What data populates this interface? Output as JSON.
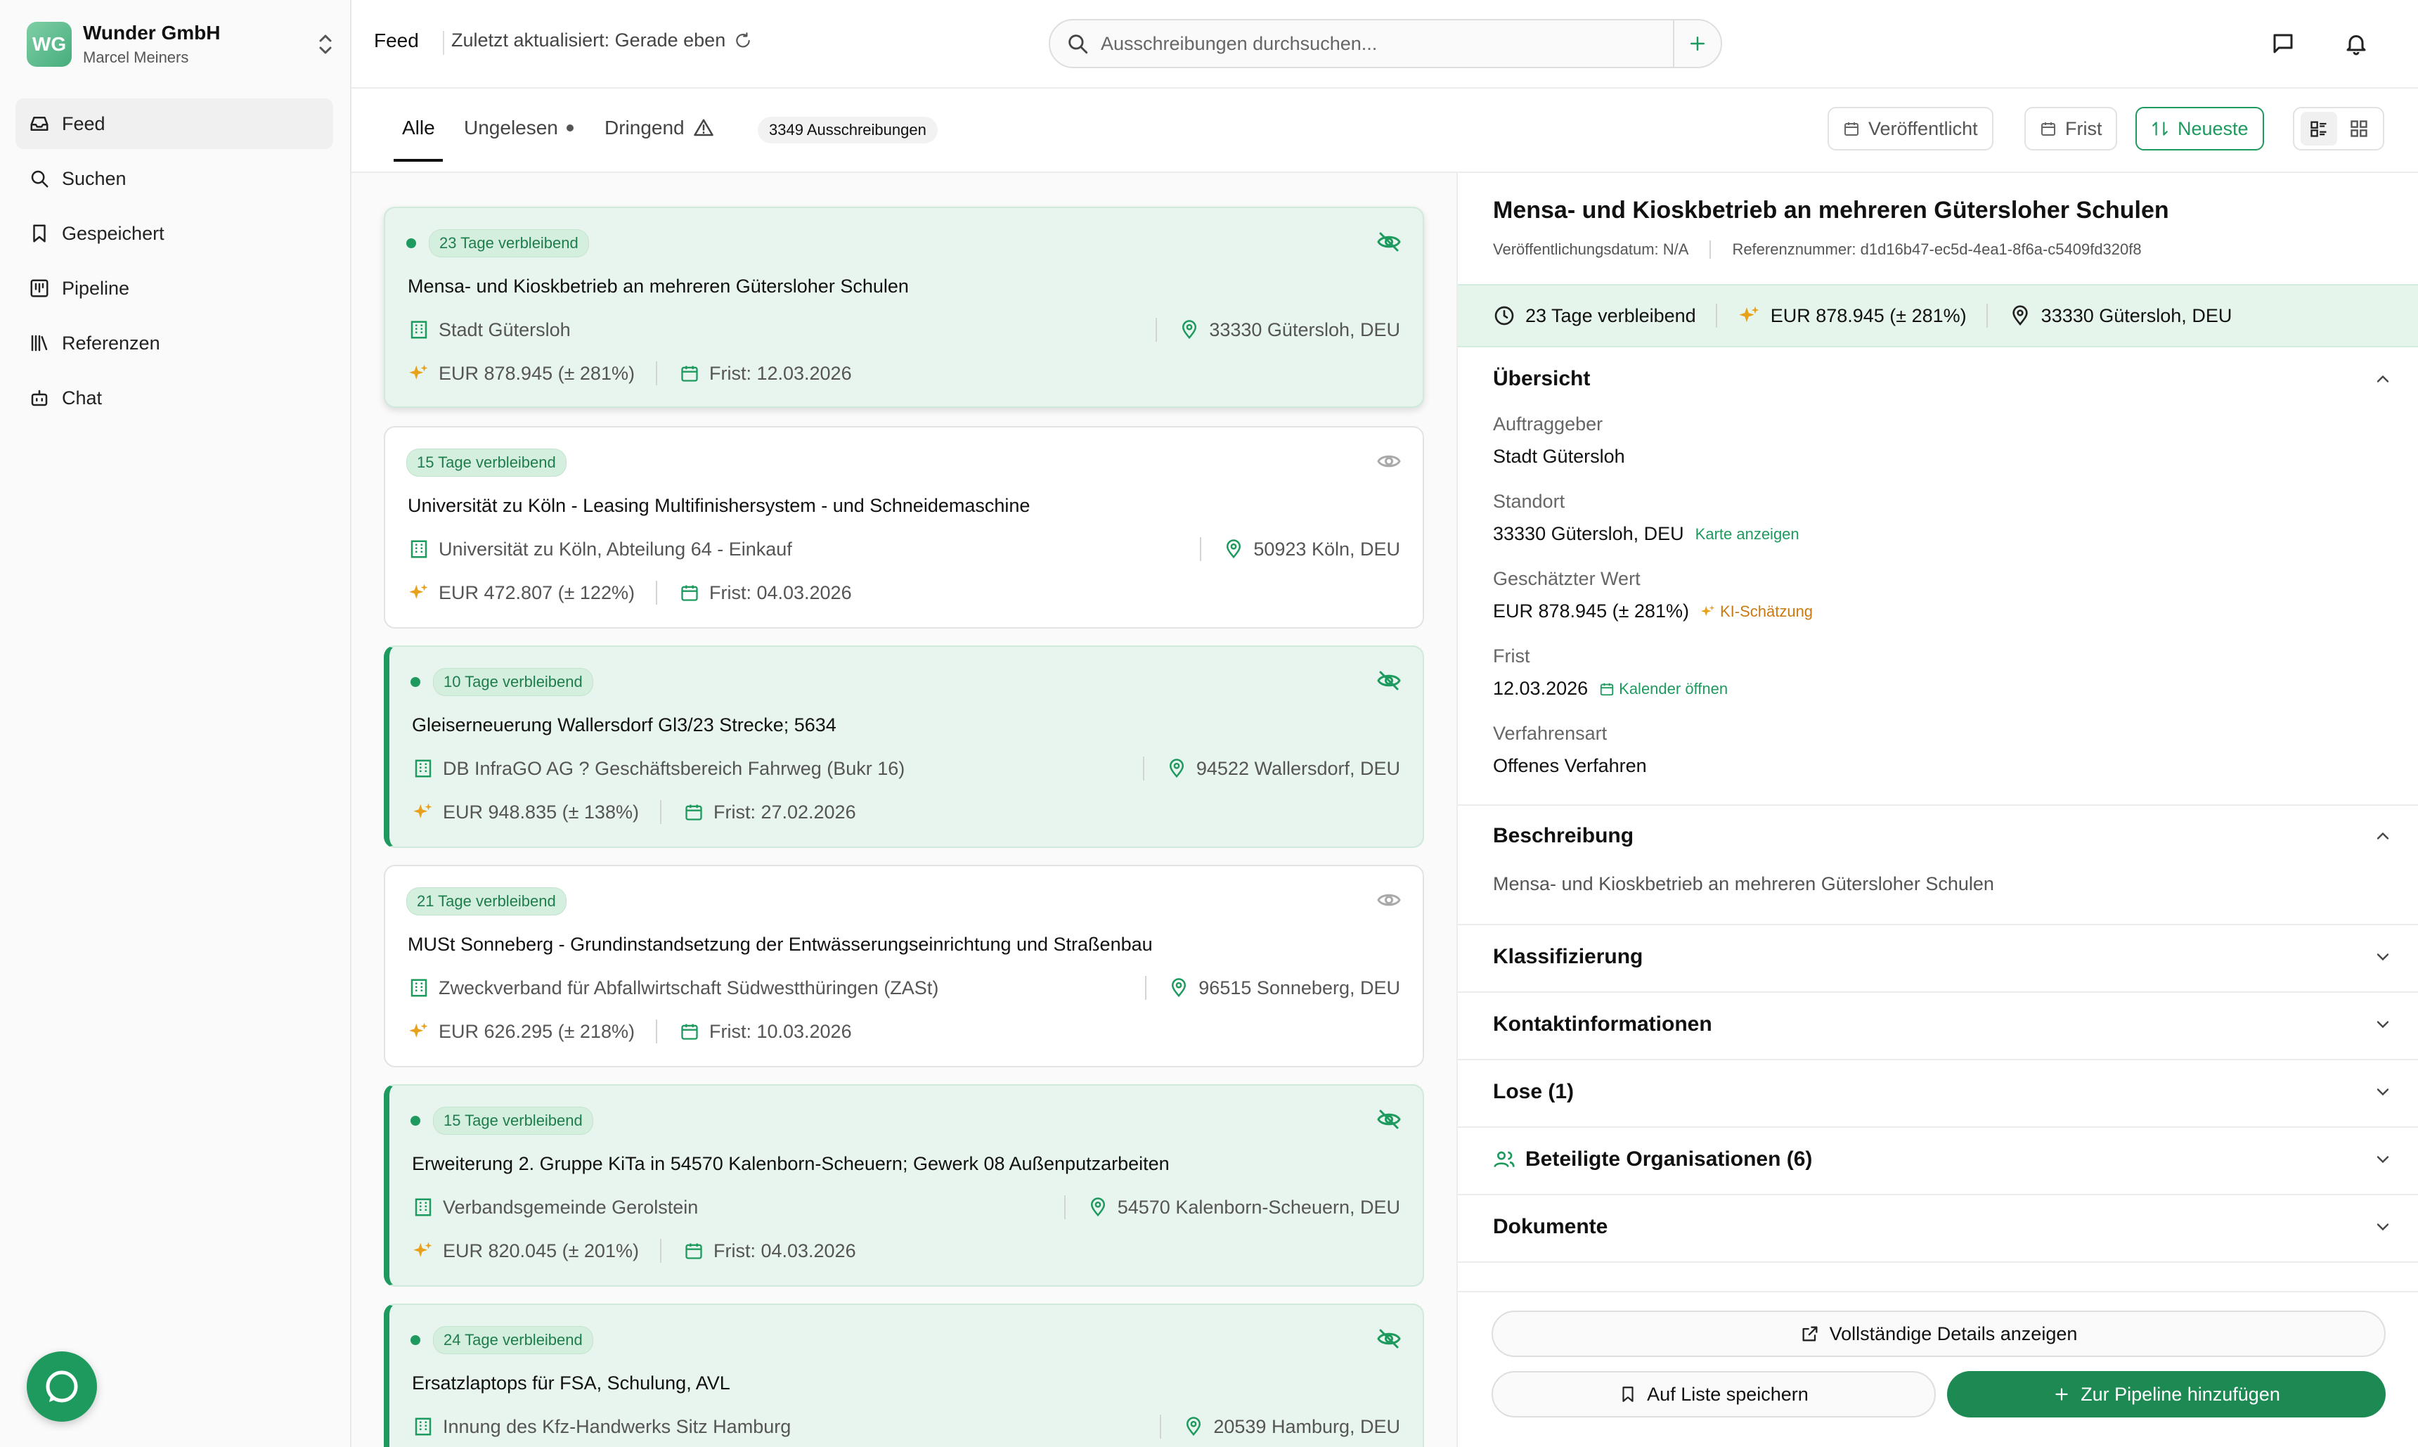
{
  "org": {
    "initials": "WG",
    "name": "Wunder GmbH",
    "user": "Marcel Meiners"
  },
  "nav": [
    {
      "label": "Feed",
      "icon": "inbox-icon"
    },
    {
      "label": "Suchen",
      "icon": "search-icon"
    },
    {
      "label": "Gespeichert",
      "icon": "bookmark-icon"
    },
    {
      "label": "Pipeline",
      "icon": "kanban-icon"
    },
    {
      "label": "Referenzen",
      "icon": "library-icon"
    },
    {
      "label": "Chat",
      "icon": "bot-icon"
    }
  ],
  "topbar": {
    "feed": "Feed",
    "updated": "Zuletzt aktualisiert: Gerade eben",
    "search_placeholder": "Ausschreibungen durchsuchen..."
  },
  "tabs": {
    "all": "Alle",
    "unread": "Ungelesen",
    "urgent": "Dringend",
    "count": "3349 Ausschreibungen"
  },
  "filters": {
    "published": "Veröffentlicht",
    "deadline": "Frist",
    "sort": "Neueste"
  },
  "cards": [
    {
      "days": "23 Tage verbleibend",
      "title": "Mensa- und Kioskbetrieb an mehreren Gütersloher Schulen",
      "org": "Stadt Gütersloh",
      "location": "33330 Gütersloh, DEU",
      "value": "EUR 878.945 (± 281%)",
      "deadline": "Frist: 12.03.2026",
      "unread": true,
      "selected": true
    },
    {
      "days": "15 Tage verbleibend",
      "title": "Universität zu Köln - Leasing Multifinishersystem - und Schneidemaschine",
      "org": "Universität zu Köln, Abteilung 64 - Einkauf",
      "location": "50923 Köln, DEU",
      "value": "EUR 472.807 (± 122%)",
      "deadline": "Frist: 04.03.2026",
      "unread": false
    },
    {
      "days": "10 Tage verbleibend",
      "title": "Gleiserneuerung Wallersdorf Gl3/23 Strecke; 5634",
      "org": "DB InfraGO AG ? Geschäftsbereich Fahrweg (Bukr 16)",
      "location": "94522 Wallersdorf, DEU",
      "value": "EUR 948.835 (± 138%)",
      "deadline": "Frist: 27.02.2026",
      "unread": true
    },
    {
      "days": "21 Tage verbleibend",
      "title": "MUSt Sonneberg - Grundinstandsetzung der Entwässerungseinrichtung und Straßenbau",
      "org": "Zweckverband für Abfallwirtschaft Südwestthüringen (ZASt)",
      "location": "96515 Sonneberg, DEU",
      "value": "EUR 626.295 (± 218%)",
      "deadline": "Frist: 10.03.2026",
      "unread": false
    },
    {
      "days": "15 Tage verbleibend",
      "title": "Erweiterung 2. Gruppe KiTa in 54570 Kalenborn-Scheuern; Gewerk 08 Außenputzarbeiten",
      "org": "Verbandsgemeinde Gerolstein",
      "location": "54570 Kalenborn-Scheuern, DEU",
      "value": "EUR 820.045 (± 201%)",
      "deadline": "Frist: 04.03.2026",
      "unread": true
    },
    {
      "days": "24 Tage verbleibend",
      "title": "Ersatzlaptops für FSA, Schulung, AVL",
      "org": "Innung des Kfz-Handwerks Sitz Hamburg",
      "location": "20539 Hamburg, DEU",
      "value": "",
      "deadline": "",
      "unread": true
    }
  ],
  "detail": {
    "title": "Mensa- und Kioskbetrieb an mehreren Gütersloher Schulen",
    "published": "Veröffentlichungsdatum: N/A",
    "reference": "Referenznummer: d1d16b47-ec5d-4ea1-8f6a-c5409fd320f8",
    "highlight": {
      "days": "23 Tage verbleibend",
      "value": "EUR 878.945 (± 281%)",
      "location": "33330 Gütersloh, DEU"
    },
    "overview": "Übersicht",
    "client_label": "Auftraggeber",
    "client": "Stadt Gütersloh",
    "location_label": "Standort",
    "location": "33330 Gütersloh, DEU",
    "map_link": "Karte anzeigen",
    "value_label": "Geschätzter Wert",
    "value": "EUR 878.945 (± 281%)",
    "ai_estimate": "KI-Schätzung",
    "deadline_label": "Frist",
    "deadline": "12.03.2026",
    "calendar_link": "Kalender öffnen",
    "procedure_label": "Verfahrensart",
    "procedure": "Offenes Verfahren",
    "description_head": "Beschreibung",
    "description": "Mensa- und Kioskbetrieb an mehreren Gütersloher Schulen",
    "classification": "Klassifizierung",
    "contact": "Kontaktinformationen",
    "lots": "Lose (1)",
    "orgs": "Beteiligte Organisationen (6)",
    "documents": "Dokumente",
    "btn_details": "Vollständige Details anzeigen",
    "btn_save": "Auf Liste speichern",
    "btn_pipeline": "Zur Pipeline hinzufügen"
  },
  "colors": {
    "accent": "#1e9a5e",
    "unread_bg": "#e8f5ee",
    "ai_orange": "#e8a11a"
  }
}
